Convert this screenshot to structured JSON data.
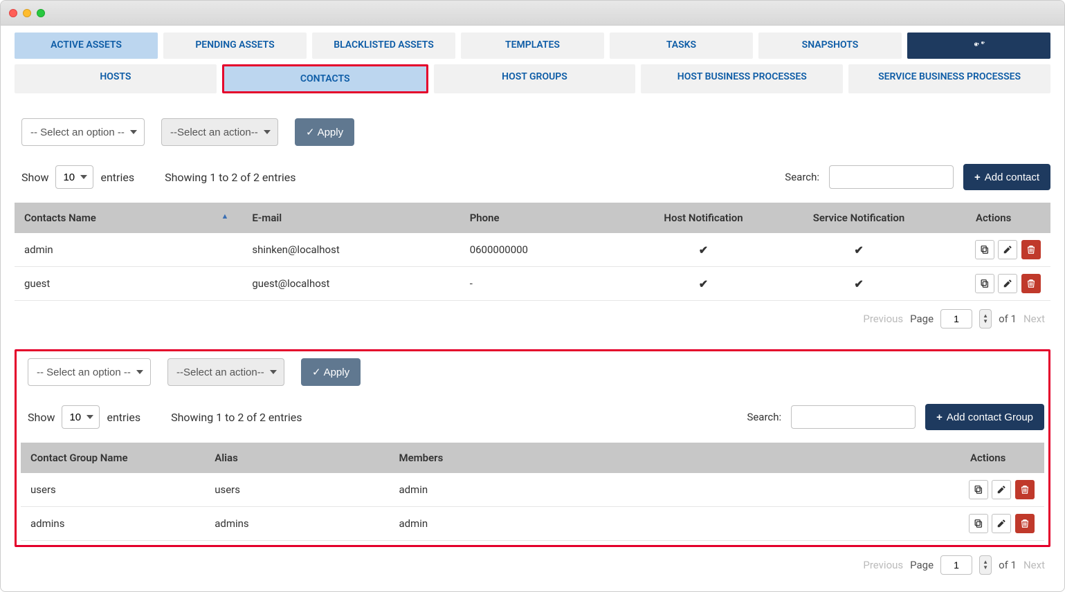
{
  "tabs": {
    "active_assets": "ACTIVE ASSETS",
    "pending_assets": "PENDING ASSETS",
    "blacklisted_assets": "BLACKLISTED ASSETS",
    "templates": "TEMPLATES",
    "tasks": "TASKS",
    "snapshots": "SNAPSHOTS"
  },
  "subtabs": {
    "hosts": "HOSTS",
    "contacts": "CONTACTS",
    "host_groups": "HOST GROUPS",
    "host_biz": "HOST BUSINESS PROCESSES",
    "svc_biz": "SERVICE BUSINESS PROCESSES"
  },
  "selects": {
    "option_ph": "-- Select an option --",
    "action_ph": "--Select an action--",
    "apply": "Apply"
  },
  "tableA": {
    "show": "Show",
    "pagesize": "10",
    "entries": "entries",
    "showing": "Showing 1 to 2 of 2 entries",
    "search_lbl": "Search:",
    "addbtn": "Add contact",
    "cols": {
      "name": "Contacts Name",
      "email": "E-mail",
      "phone": "Phone",
      "hostnotif": "Host Notification",
      "svcnotif": "Service Notification",
      "actions": "Actions"
    },
    "rows": [
      {
        "name": "admin",
        "email": "shinken@localhost",
        "phone": "0600000000",
        "host": true,
        "svc": true
      },
      {
        "name": "guest",
        "email": "guest@localhost",
        "phone": "-",
        "host": true,
        "svc": true
      }
    ],
    "pager": {
      "prev": "Previous",
      "page_lbl": "Page",
      "page": "1",
      "of": "of 1",
      "next": "Next"
    }
  },
  "tableB": {
    "show": "Show",
    "pagesize": "10",
    "entries": "entries",
    "showing": "Showing 1 to 2 of 2 entries",
    "search_lbl": "Search:",
    "addbtn": "Add contact Group",
    "cols": {
      "name": "Contact Group Name",
      "alias": "Alias",
      "members": "Members",
      "actions": "Actions"
    },
    "rows": [
      {
        "name": "users",
        "alias": "users",
        "members": "admin"
      },
      {
        "name": "admins",
        "alias": "admins",
        "members": "admin"
      }
    ],
    "pager": {
      "prev": "Previous",
      "page_lbl": "Page",
      "page": "1",
      "of": "of 1",
      "next": "Next"
    }
  }
}
